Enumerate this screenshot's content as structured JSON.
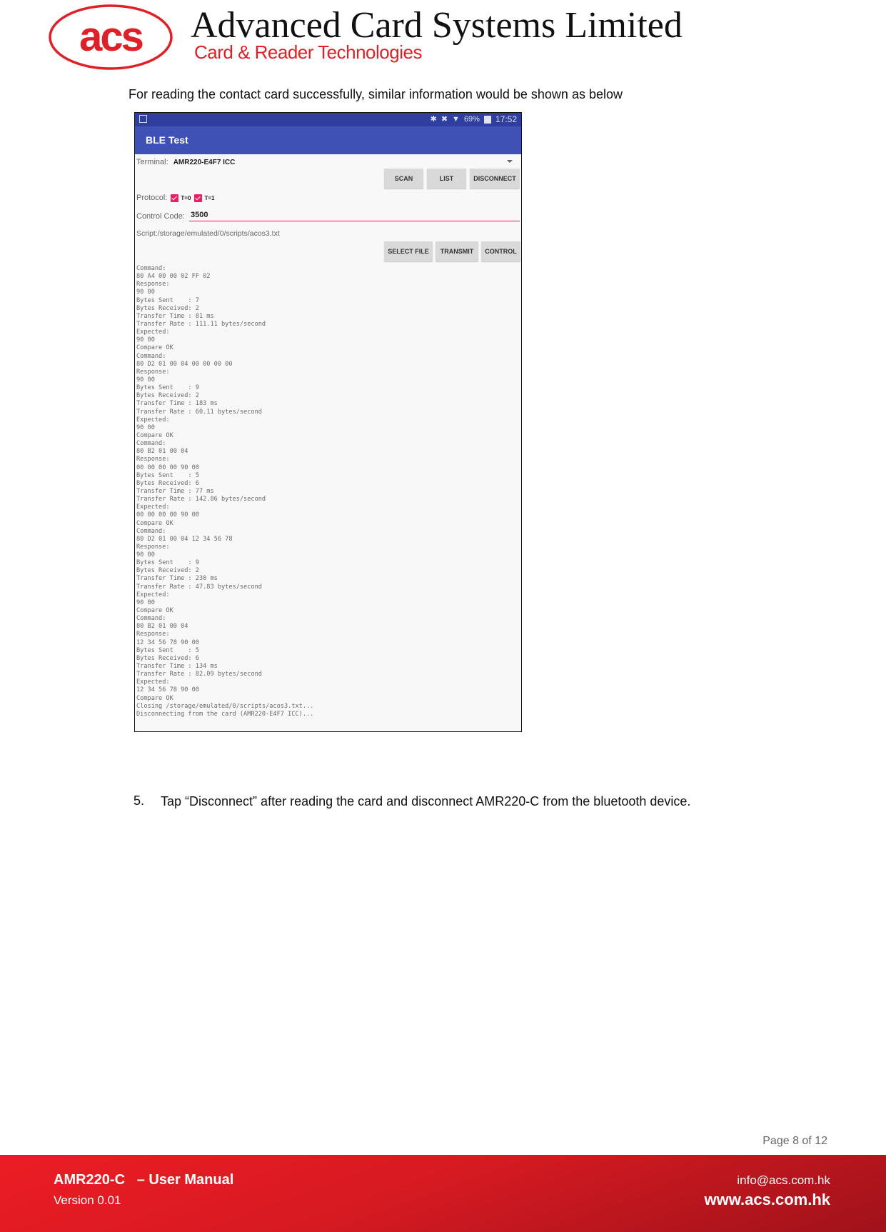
{
  "header": {
    "logo_text": "acs",
    "company_name": "Advanced Card Systems Limited",
    "tagline": "Card & Reader Technologies",
    "brand_color": "#e01f26"
  },
  "intro_text": "For reading the contact card successfully, similar information would be shown as below",
  "screenshot": {
    "statusbar": {
      "icons": [
        "bluetooth-icon",
        "mute-icon",
        "wifi-icon",
        "battery-icon"
      ],
      "battery": "69%",
      "time": "17:52"
    },
    "app_title": "BLE Test",
    "terminal_label": "Terminal:",
    "terminal_value": "AMR220-E4F7 ICC",
    "buttons": {
      "scan": "SCAN",
      "list": "LIST",
      "disconnect": "DISCONNECT",
      "select_file": "SELECT FILE",
      "transmit": "TRANSMIT",
      "control": "CONTROL"
    },
    "protocol_label": "Protocol:",
    "protocols": [
      {
        "label": "T=0",
        "checked": true
      },
      {
        "label": "T=1",
        "checked": true
      }
    ],
    "control_code_label": "Control Code:",
    "control_code_value": "3500",
    "script_path": "Script:/storage/emulated/0/scripts/acos3.txt",
    "accent_color": "#e91e63",
    "primary_color": "#3f51b5",
    "log_lines": [
      "Command:",
      "80 A4 00 00 02 FF 02",
      "Response:",
      "90 00",
      "Bytes Sent    : 7",
      "Bytes Received: 2",
      "Transfer Time : 81 ms",
      "Transfer Rate : 111.11 bytes/second",
      "Expected:",
      "90 00",
      "Compare OK",
      "Command:",
      "80 D2 01 00 04 00 00 00 00",
      "Response:",
      "90 00",
      "Bytes Sent    : 9",
      "Bytes Received: 2",
      "Transfer Time : 183 ms",
      "Transfer Rate : 60.11 bytes/second",
      "Expected:",
      "90 00",
      "Compare OK",
      "Command:",
      "80 B2 01 00 04",
      "Response:",
      "00 00 00 00 90 00",
      "Bytes Sent    : 5",
      "Bytes Received: 6",
      "Transfer Time : 77 ms",
      "Transfer Rate : 142.86 bytes/second",
      "Expected:",
      "00 00 00 00 90 00",
      "Compare OK",
      "Command:",
      "80 D2 01 00 04 12 34 56 78",
      "Response:",
      "90 00",
      "Bytes Sent    : 9",
      "Bytes Received: 2",
      "Transfer Time : 230 ms",
      "Transfer Rate : 47.83 bytes/second",
      "Expected:",
      "90 00",
      "Compare OK",
      "Command:",
      "80 B2 01 00 04",
      "Response:",
      "12 34 56 78 90 00",
      "Bytes Sent    : 5",
      "Bytes Received: 6",
      "Transfer Time : 134 ms",
      "Transfer Rate : 82.09 bytes/second",
      "Expected:",
      "12 34 56 78 90 00",
      "Compare OK",
      "Closing /storage/emulated/0/scripts/acos3.txt...",
      "Disconnecting from the card (AMR220-E4F7 ICC)..."
    ]
  },
  "step": {
    "number": "5.",
    "text": "Tap “Disconnect” after reading the card and disconnect AMR220-C from the bluetooth device."
  },
  "footer": {
    "page": "Page 8 of 12",
    "manual_title": "AMR220-C   – User Manual",
    "version": "Version 0.01",
    "email": "info@acs.com.hk",
    "website": "www.acs.com.hk",
    "color": "#e31b23"
  }
}
